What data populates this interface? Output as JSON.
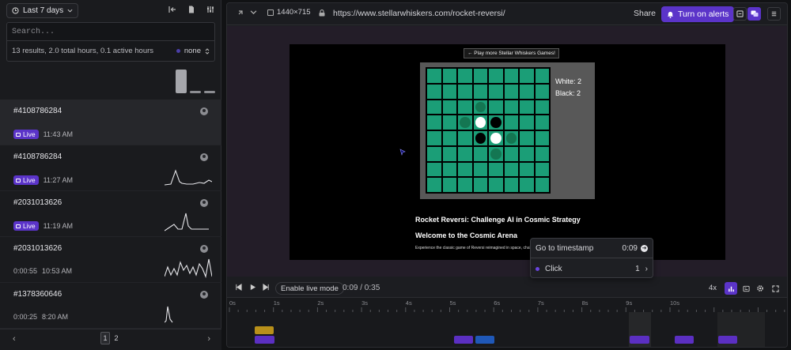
{
  "left_panel": {
    "date_range": "Last 7 days",
    "search": {
      "placeholder": "Search..."
    },
    "stats": {
      "summary": "13 results, 2.0 total hours, 0.1 active hours",
      "filter": "none"
    },
    "sessions": [
      {
        "id": "#4108786284",
        "live": true,
        "live_label": "Live",
        "duration": "",
        "time": "11:43 AM"
      },
      {
        "id": "#4108786284",
        "live": true,
        "live_label": "Live",
        "duration": "",
        "time": "11:27 AM"
      },
      {
        "id": "#2031013626",
        "live": true,
        "live_label": "Live",
        "duration": "",
        "time": "11:19 AM"
      },
      {
        "id": "#2031013626",
        "live": false,
        "live_label": "",
        "duration": "0:00:55",
        "time": "10:53 AM"
      },
      {
        "id": "#1378360646",
        "live": false,
        "live_label": "",
        "duration": "0:00:25",
        "time": "8:20 AM"
      }
    ],
    "pager": {
      "prev": "‹",
      "next": "›",
      "pages": [
        "1",
        "2"
      ],
      "current": "1"
    }
  },
  "player": {
    "resolution": "1440×715",
    "url": "https://www.stellarwhiskers.com/rocket-reversi/",
    "share": "Share",
    "alerts": "Turn on alerts",
    "game": {
      "play_more": "← Play more Stellar Whiskers Games!",
      "score_white": "White: 2",
      "score_black": "Black: 2",
      "title": "Rocket Reversi: Challenge AI in Cosmic Strategy",
      "subtitle": "Welcome to the Cosmic Arena",
      "description": "Experience the classic game of Reversi reimagined in space, challenge sophisticated AI opponents in this strategic battle of wits."
    },
    "popup": {
      "goto": "Go to timestamp",
      "goto_time": "0:09",
      "event": "Click",
      "event_count": "1",
      "event_arrow": "›"
    },
    "controls": {
      "live_mode": "Enable live mode",
      "time": "0:09 / 0:35",
      "speed": "4x"
    },
    "timeline_ticks": [
      "0s",
      "1s",
      "2s",
      "3s",
      "4s",
      "5s",
      "6s",
      "7s",
      "8s",
      "9s",
      "10s"
    ]
  },
  "colors": {
    "accent": "#5b34c9",
    "board_green": "#1b9e77",
    "event_yellow": "#b8901a",
    "event_blue": "#1f58b8",
    "event_purple": "#5b2fc2"
  }
}
